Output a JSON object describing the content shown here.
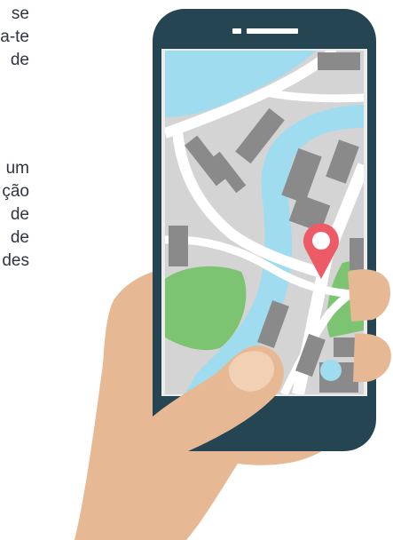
{
  "text_fragments": {
    "block_1": [
      "se",
      "a-te",
      "de"
    ],
    "block_2": [
      "um",
      "ção",
      "de",
      "de",
      "des"
    ]
  },
  "colors": {
    "phone_dark": "#264553",
    "map_background": "#d4d4d4",
    "water": "#9fdcef",
    "road": "#ffffff",
    "building": "#8a8a8a",
    "park": "#7dc472",
    "pin": "#ec5b66",
    "skin": "#e6b894",
    "skin_light": "#f1d0b4",
    "text": "#2f3440"
  },
  "icons": {
    "location_pin": "location-pin-icon",
    "speaker": "earpiece-speaker"
  }
}
